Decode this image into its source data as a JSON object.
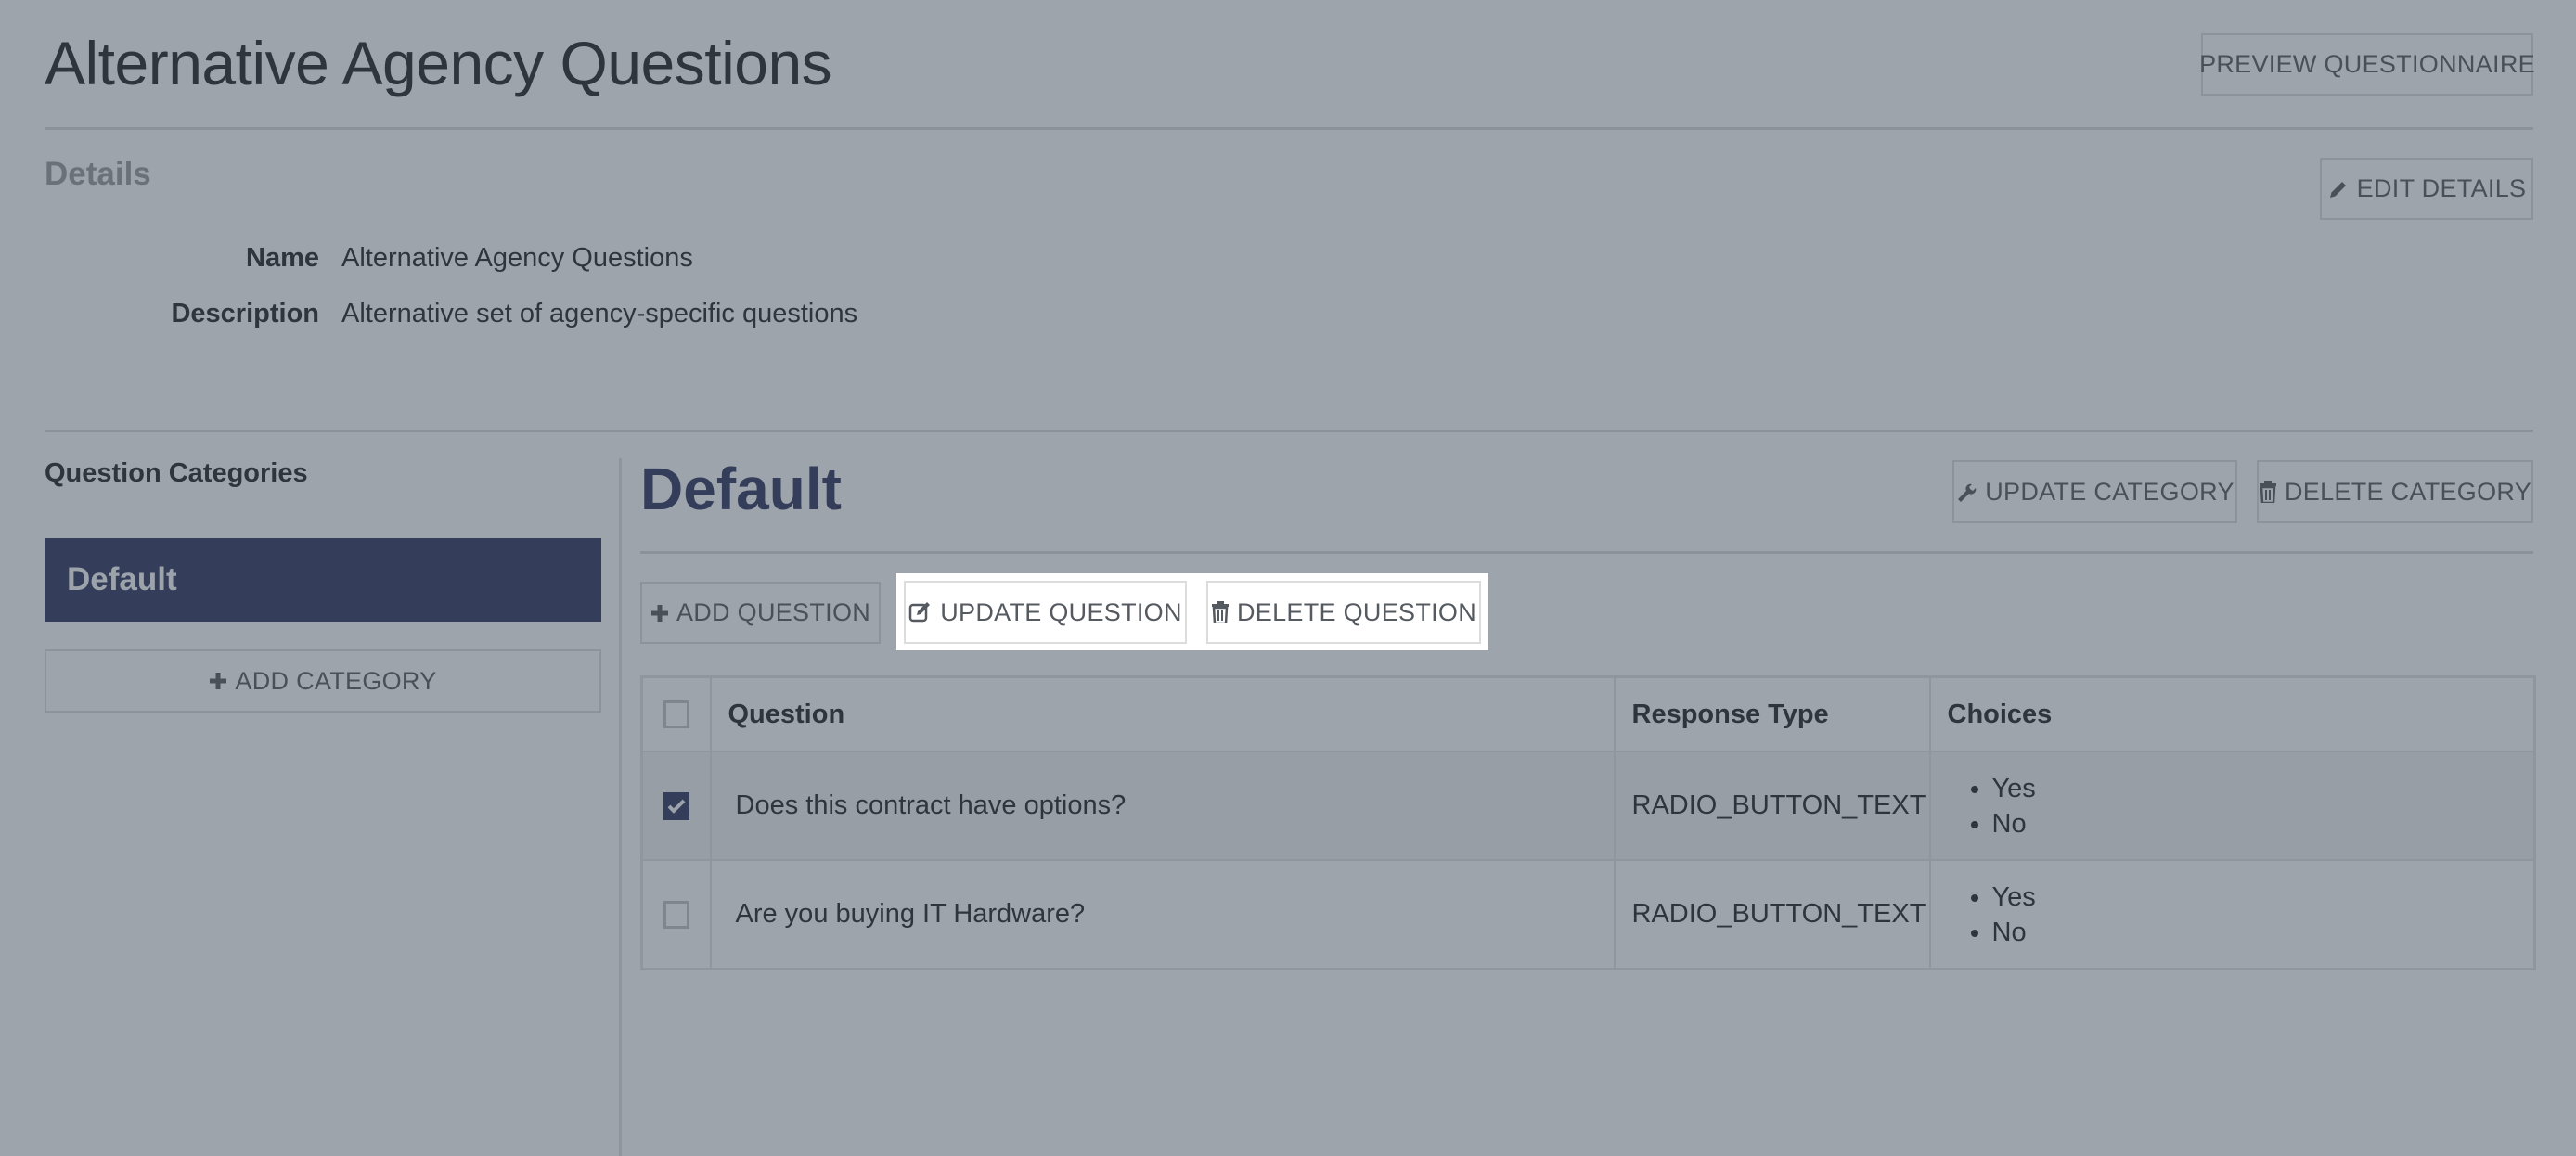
{
  "header": {
    "title": "Alternative Agency Questions",
    "preview_button": "PREVIEW QUESTIONNAIRE"
  },
  "details": {
    "section_title": "Details",
    "edit_button": "EDIT DETAILS",
    "fields": [
      {
        "label": "Name",
        "value": "Alternative Agency Questions"
      },
      {
        "label": "Description",
        "value": "Alternative set of agency-specific questions"
      }
    ]
  },
  "sidebar": {
    "title": "Question Categories",
    "categories": [
      {
        "label": "Default",
        "selected": true
      }
    ],
    "add_category_button": "ADD CATEGORY"
  },
  "category": {
    "title": "Default",
    "update_button": "UPDATE CATEGORY",
    "delete_button": "DELETE CATEGORY",
    "add_question_button": "ADD QUESTION",
    "update_question_button": "UPDATE QUESTION",
    "delete_question_button": "DELETE QUESTION"
  },
  "table": {
    "columns": [
      "Question",
      "Response Type",
      "Choices"
    ],
    "rows": [
      {
        "checked": true,
        "question": "Does this contract have options?",
        "response_type": "RADIO_BUTTON_TEXT",
        "choices": [
          "Yes",
          "No"
        ]
      },
      {
        "checked": false,
        "question": "Are you buying IT Hardware?",
        "response_type": "RADIO_BUTTON_TEXT",
        "choices": [
          "Yes",
          "No"
        ]
      }
    ]
  },
  "colors": {
    "overlay_background": "#9da4ac",
    "accent_navy": "#343d59",
    "highlight": "#ffffff"
  }
}
